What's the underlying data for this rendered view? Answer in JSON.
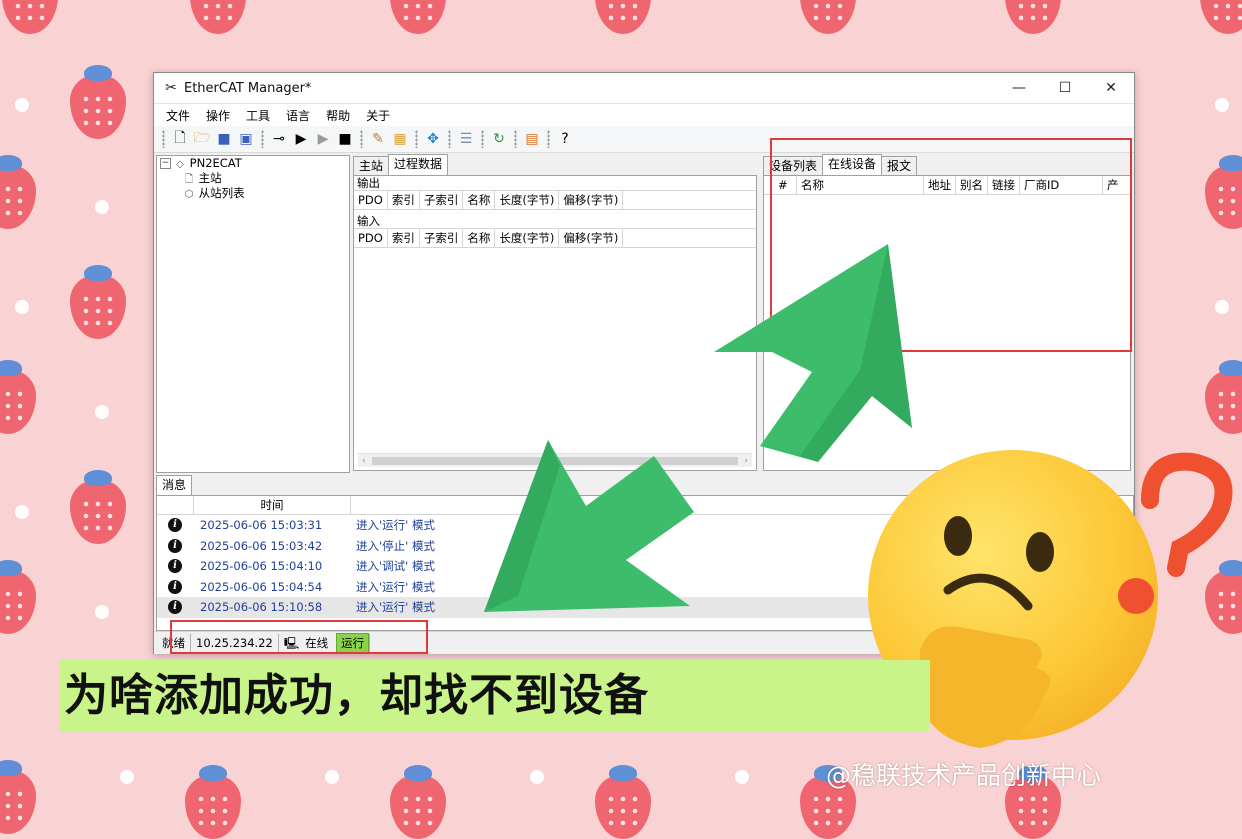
{
  "window": {
    "title": "EtherCAT Manager*",
    "controls": {
      "minimize": "—",
      "maximize": "☐",
      "close": "✕"
    }
  },
  "menu": [
    "文件",
    "操作",
    "工具",
    "语言",
    "帮助",
    "关于"
  ],
  "toolbar": [
    "new-file-icon",
    "open-folder-icon",
    "save-icon",
    "save-as-icon",
    "connect-icon",
    "play-icon",
    "step-icon",
    "stop-icon",
    "tools-icon",
    "package-icon",
    "network-icon",
    "list-icon",
    "refresh-icon",
    "export-icon",
    "help-icon"
  ],
  "tree": {
    "root": "PN2ECAT",
    "master": "主站",
    "slaves": "从站列表"
  },
  "middle": {
    "tabs": [
      "主站",
      "过程数据"
    ],
    "output_label": "输出",
    "input_label": "输入",
    "columns": [
      "PDO",
      "索引",
      "子索引",
      "名称",
      "长度(字节)",
      "偏移(字节)"
    ]
  },
  "right": {
    "tabs": [
      "设备列表",
      "在线设备",
      "报文"
    ],
    "columns": [
      "#",
      "名称",
      "地址",
      "别名",
      "链接",
      "厂商ID",
      "产"
    ]
  },
  "messages": {
    "tab": "消息",
    "time_header": "时间",
    "rows": [
      {
        "time": "2025-06-06 15:03:31",
        "text": "进入'运行' 模式"
      },
      {
        "time": "2025-06-06 15:03:42",
        "text": "进入'停止' 模式"
      },
      {
        "time": "2025-06-06 15:04:10",
        "text": "进入'调试' 模式"
      },
      {
        "time": "2025-06-06 15:04:54",
        "text": "进入'运行' 模式"
      },
      {
        "time": "2025-06-06 15:10:58",
        "text": "进入'运行' 模式"
      }
    ]
  },
  "status": {
    "ready": "就绪",
    "ip": "10.25.234.22",
    "online": "在线",
    "run": "运行"
  },
  "caption": "为啥添加成功，却找不到设备",
  "watermark": "@稳联技术产品创新中心",
  "colors": {
    "background": "#f9d3d3",
    "highlight_box": "#e23a3a",
    "arrow": "#3dbd6b",
    "caption_bg": "#c9f48a",
    "run_badge": "#8bd24b"
  }
}
